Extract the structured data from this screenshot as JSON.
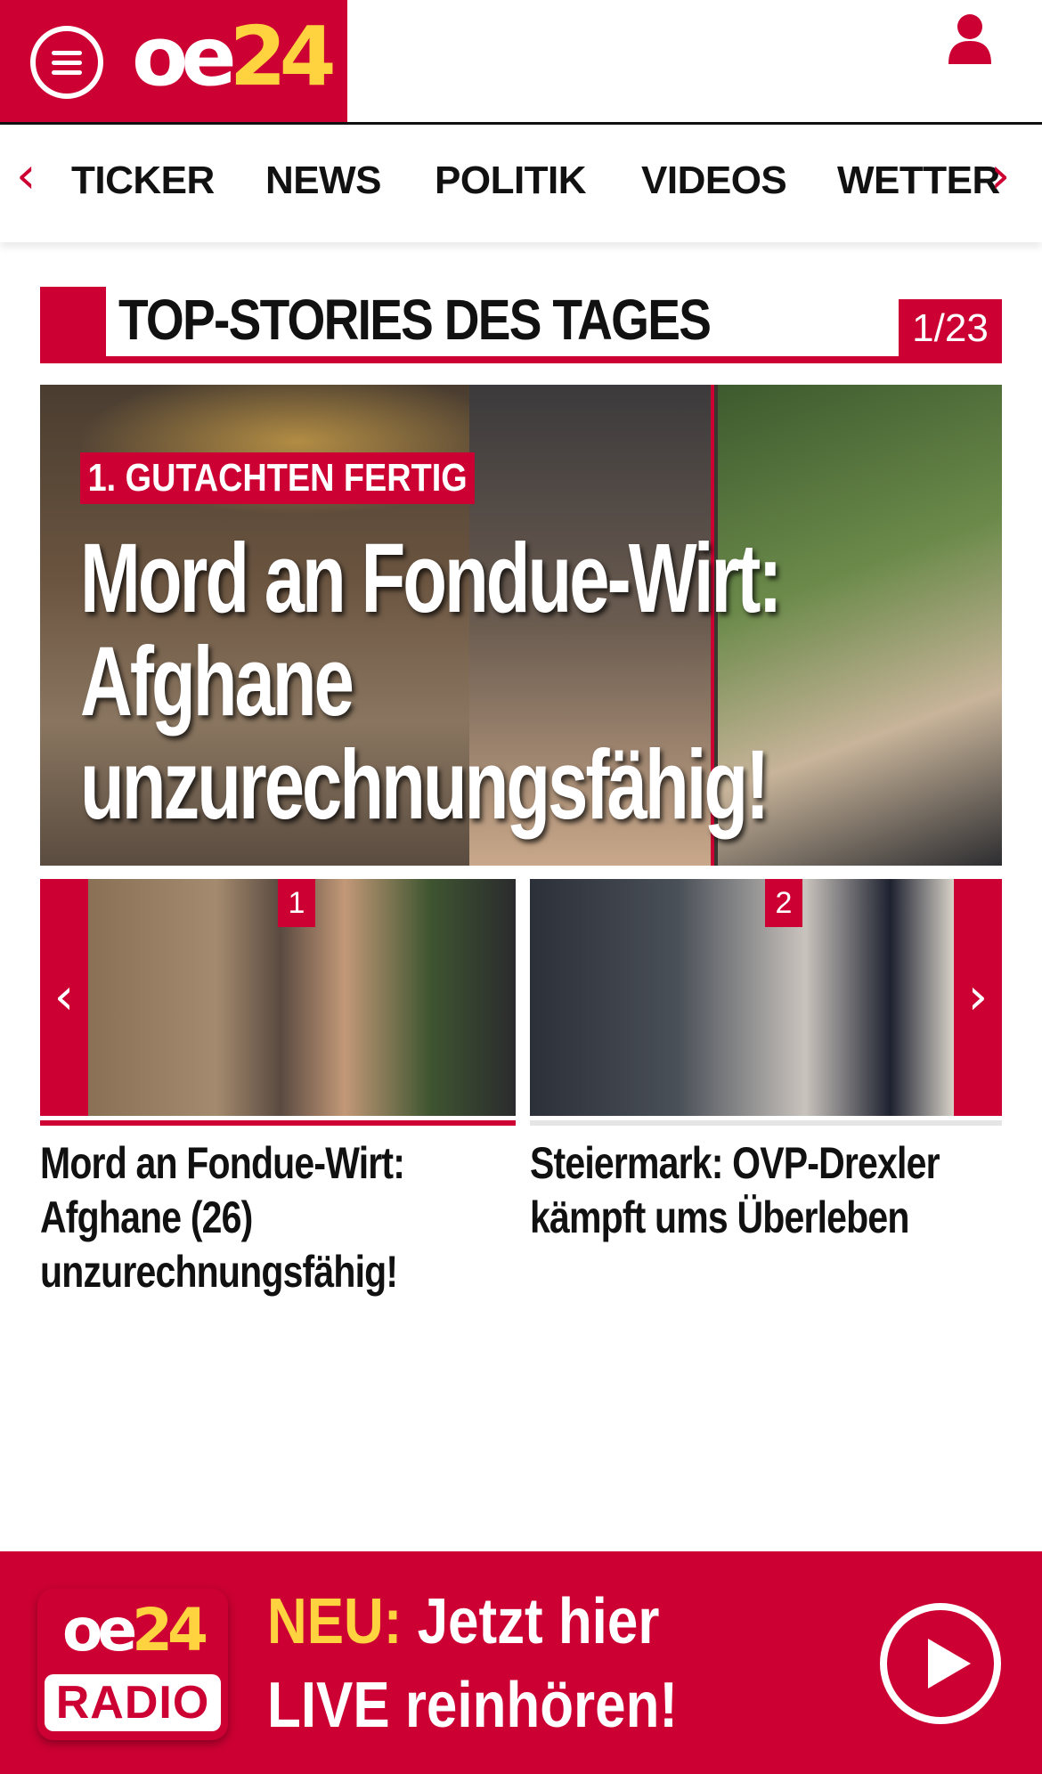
{
  "header": {
    "logo_oe": "oe",
    "logo_24": "24",
    "menu_icon": "hamburger-menu-icon",
    "user_icon": "user-icon"
  },
  "nav": {
    "items": [
      "TICKER",
      "NEWS",
      "POLITIK",
      "VIDEOS",
      "WETTER"
    ],
    "left_arrow": "‹",
    "right_arrow": "›"
  },
  "section": {
    "title": "TOP-STORIES DES TAGES",
    "counter": "1/23"
  },
  "hero": {
    "kicker": "1. GUTACHTEN FERTIG",
    "title": "Mord an Fondue-Wirt: Afghane unzurechnungsfähig!"
  },
  "carousel": {
    "left_arrow": "‹",
    "right_arrow": "›",
    "items": [
      {
        "badge": "1",
        "title": "Mord an Fondue-Wirt: Afghane (26) unzurechnungsfähig!"
      },
      {
        "badge": "2",
        "title": "Steiermark: OVP-Drexler kämpft ums Überleben"
      }
    ]
  },
  "radio": {
    "logo_oe": "oe",
    "logo_24": "24",
    "logo_radio": "RADIO",
    "neu": "NEU:",
    "line1": "Jetzt hier",
    "line2": "LIVE reinhören!"
  },
  "colors": {
    "brand_red": "#cc0033",
    "brand_yellow": "#ffd23f"
  }
}
